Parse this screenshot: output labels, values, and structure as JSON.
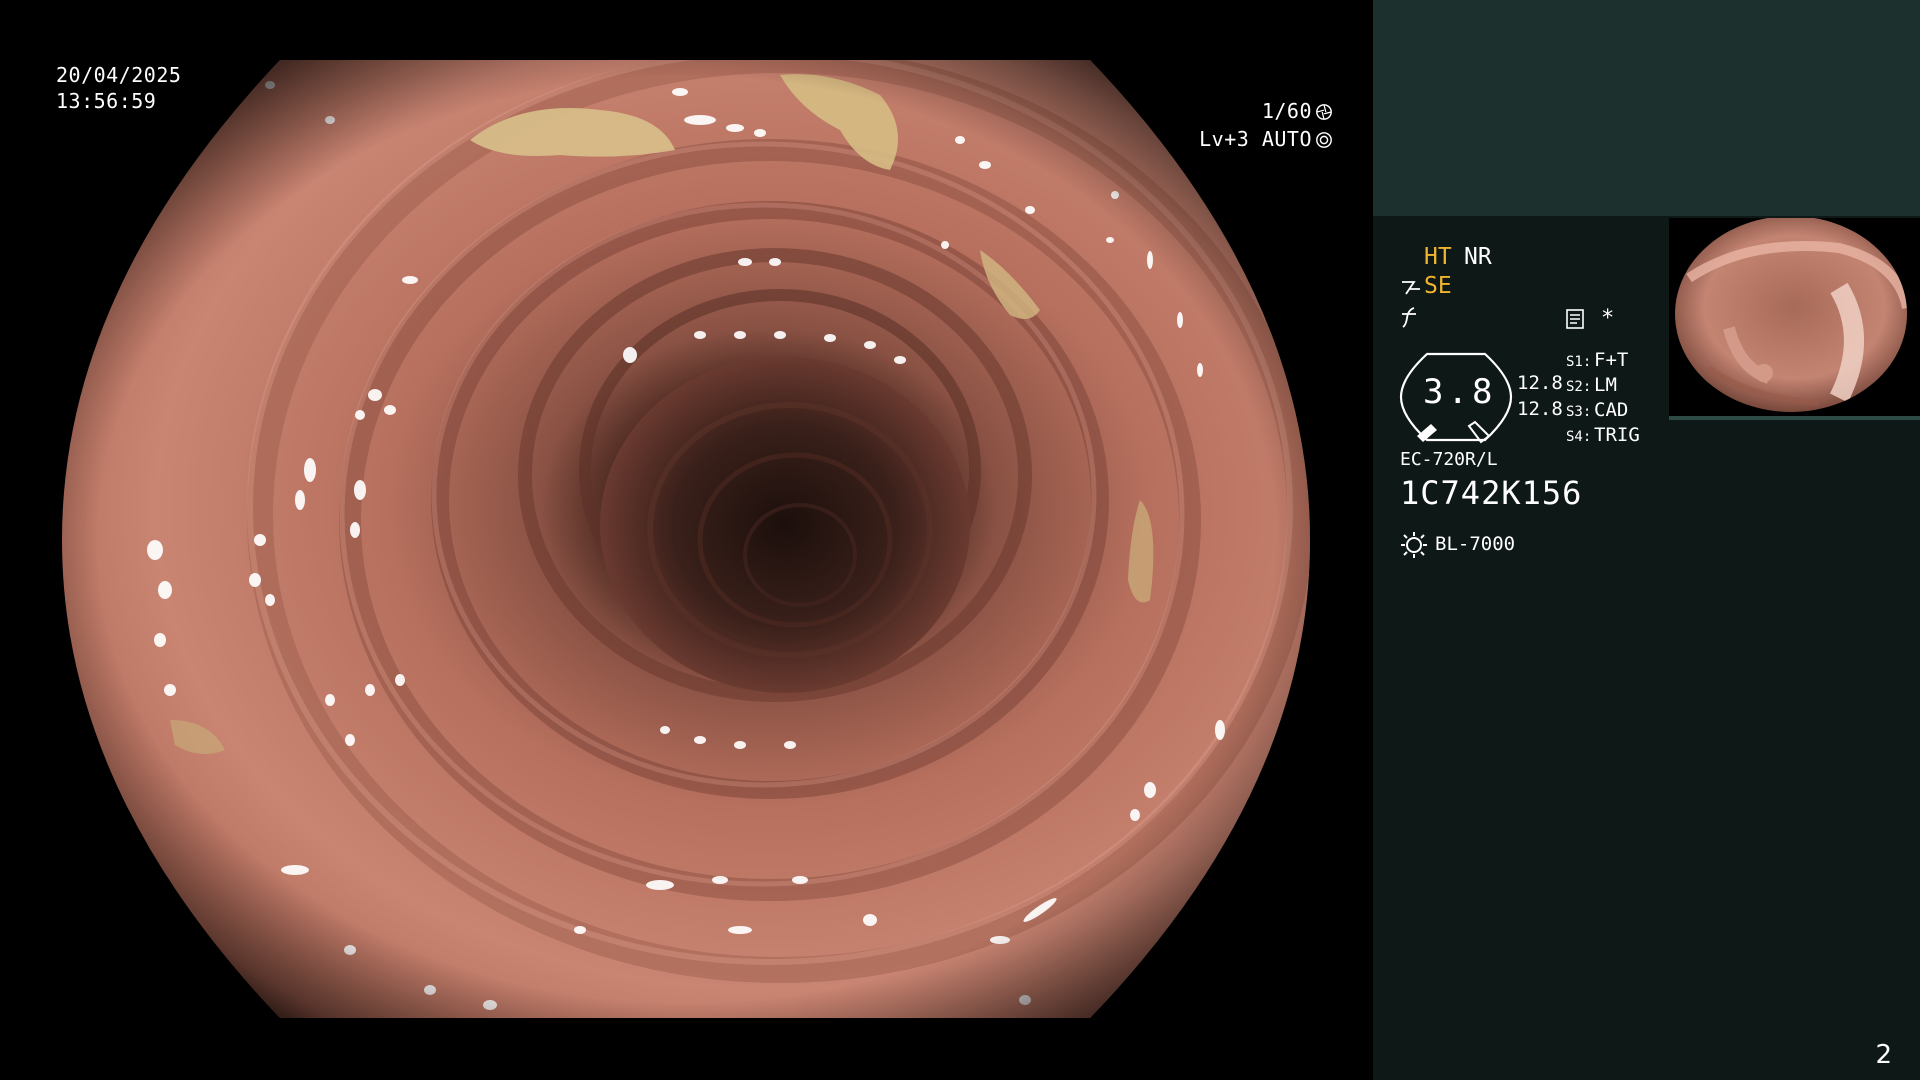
{
  "overlay": {
    "date": "20/04/2025",
    "time": "13:56:59",
    "shutter": "1/60",
    "shutter_icon": "aperture-icon",
    "level": "Lv+3 AUTO",
    "level_icon": "auto-exposure-icon"
  },
  "panel": {
    "ht": "HT",
    "nr": "NR",
    "se": "SE",
    "se_icon": "structure-enhance-icon",
    "filter_icon": "filter-icon",
    "memo_icon": "memo-icon",
    "asterisk": "*",
    "gauge": {
      "value": "3.8",
      "reading_1": "12.8",
      "reading_2": "12.8"
    },
    "switches": [
      {
        "key": "S1:",
        "value": "F+T"
      },
      {
        "key": "S2:",
        "value": "LM"
      },
      {
        "key": "S3:",
        "value": "CAD"
      },
      {
        "key": "S4:",
        "value": "TRIG"
      }
    ],
    "scope_model": "EC-720R/L",
    "scope_serial": "1C742K156",
    "light_icon": "light-source-icon",
    "light_source": "BL-7000"
  },
  "page_number": "2",
  "colors": {
    "panel_bg": "#0e1816",
    "panel_top_band": "#1c302d",
    "amber": "#f0b430",
    "mucosa": "#c17a68"
  }
}
